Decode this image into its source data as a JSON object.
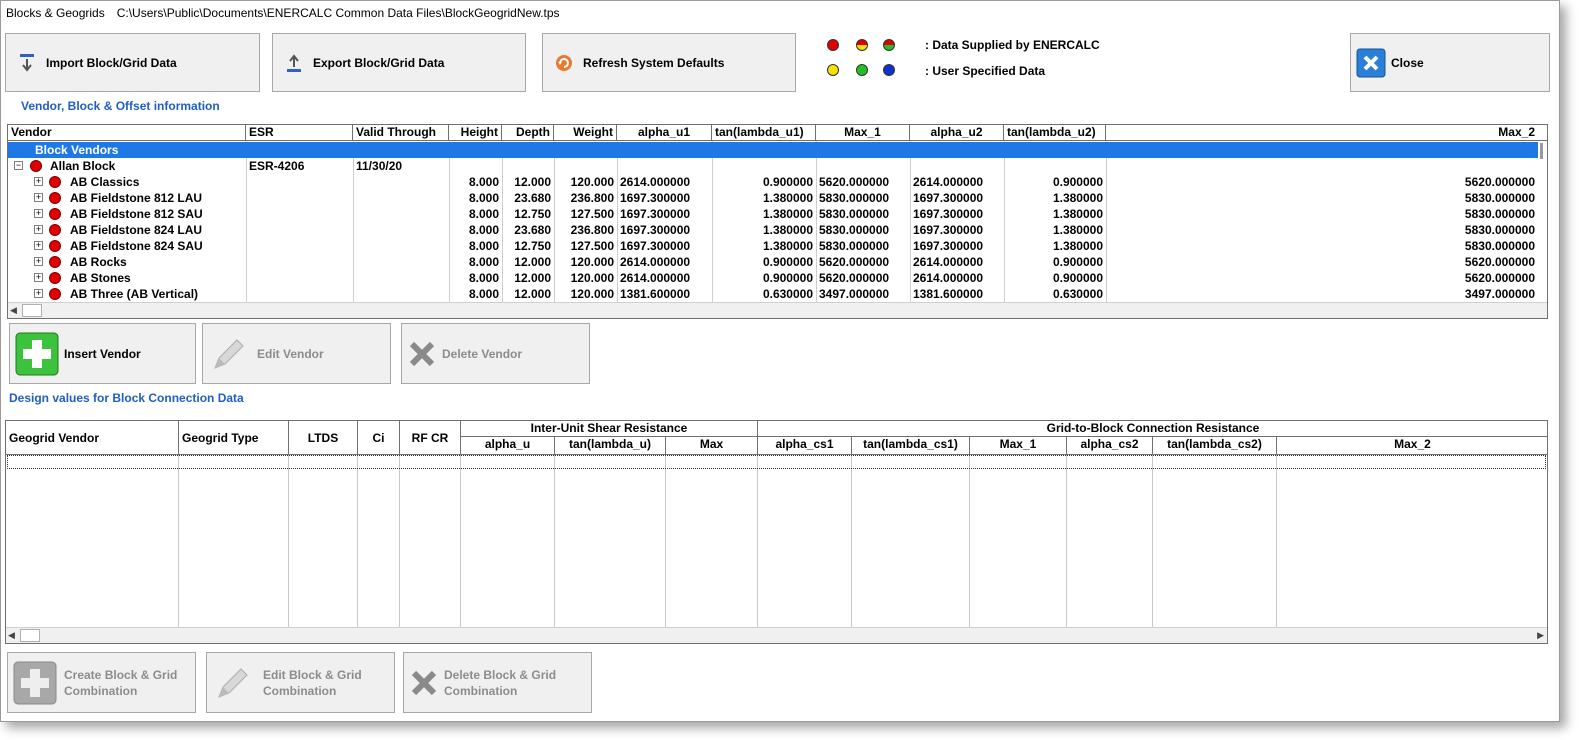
{
  "window": {
    "title": "Blocks & Geogrids",
    "path": "C:\\Users\\Public\\Documents\\ENERCALC Common Data Files\\BlockGeogridNew.tps"
  },
  "toolbar": {
    "import_label": "Import Block/Grid Data",
    "export_label": "Export Block/Grid Data",
    "refresh_label": "Refresh System Defaults",
    "close_label": "Close"
  },
  "legend": {
    "supplied_label": ": Data Supplied by ENERCALC",
    "user_label": ": User Specified Data",
    "colors": {
      "red": "#e00000",
      "yellow": "#f5e000",
      "green": "#22c022",
      "blue": "#1030d0"
    }
  },
  "vendor_section": {
    "title": "Vendor, Block & Offset information",
    "columns": [
      "Vendor",
      "ESR",
      "Valid Through",
      "Height",
      "Depth",
      "Weight",
      "alpha_u1",
      "tan(lambda_u1)",
      "Max_1",
      "alpha_u2",
      "tan(lambda_u2)",
      "Max_2"
    ],
    "group_label": "Block Vendors",
    "vendor": {
      "name": "Allan Block",
      "esr": "ESR-4206",
      "valid_through": "11/30/20"
    },
    "rows": [
      [
        "AB Classics",
        "8.000",
        "12.000",
        "120.000",
        "2614.000000",
        "0.900000",
        "5620.000000",
        "2614.000000",
        "0.900000",
        "5620.000000"
      ],
      [
        "AB Fieldstone 812 LAU",
        "8.000",
        "23.680",
        "236.800",
        "1697.300000",
        "1.380000",
        "5830.000000",
        "1697.300000",
        "1.380000",
        "5830.000000"
      ],
      [
        "AB Fieldstone 812 SAU",
        "8.000",
        "12.750",
        "127.500",
        "1697.300000",
        "1.380000",
        "5830.000000",
        "1697.300000",
        "1.380000",
        "5830.000000"
      ],
      [
        "AB Fieldstone 824 LAU",
        "8.000",
        "23.680",
        "236.800",
        "1697.300000",
        "1.380000",
        "5830.000000",
        "1697.300000",
        "1.380000",
        "5830.000000"
      ],
      [
        "AB Fieldstone 824 SAU",
        "8.000",
        "12.750",
        "127.500",
        "1697.300000",
        "1.380000",
        "5830.000000",
        "1697.300000",
        "1.380000",
        "5830.000000"
      ],
      [
        "AB Rocks",
        "8.000",
        "12.000",
        "120.000",
        "2614.000000",
        "0.900000",
        "5620.000000",
        "2614.000000",
        "0.900000",
        "5620.000000"
      ],
      [
        "AB Stones",
        "8.000",
        "12.000",
        "120.000",
        "2614.000000",
        "0.900000",
        "5620.000000",
        "2614.000000",
        "0.900000",
        "5620.000000"
      ],
      [
        "AB Three (AB Vertical)",
        "8.000",
        "12.000",
        "120.000",
        "1381.600000",
        "0.630000",
        "3497.000000",
        "1381.600000",
        "0.630000",
        "3497.000000"
      ]
    ],
    "insert_label": "Insert Vendor",
    "edit_label": "Edit Vendor",
    "delete_label": "Delete Vendor"
  },
  "connection_section": {
    "title": "Design values for Block Connection Data",
    "group_shear": "Inter-Unit Shear Resistance",
    "group_grid": "Grid-to-Block Connection Resistance",
    "columns": [
      "Geogrid Vendor",
      "Geogrid Type",
      "LTDS",
      "Ci",
      "RF CR"
    ],
    "shear_columns": [
      "alpha_u",
      "tan(lambda_u)",
      "Max"
    ],
    "grid_columns": [
      "alpha_cs1",
      "tan(lambda_cs1)",
      "Max_1",
      "alpha_cs2",
      "tan(lambda_cs2)",
      "Max_2"
    ],
    "create_label_1": "Create Block & Grid",
    "create_label_2": "Combination",
    "edit_label_1": "Edit Block & Grid",
    "edit_label_2": "Combination",
    "delete_label_1": "Delete Block & Grid",
    "delete_label_2": "Combination"
  }
}
